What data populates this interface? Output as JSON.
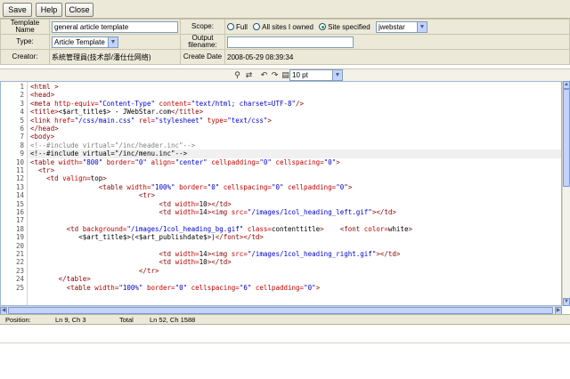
{
  "toolbar": {
    "save": "Save",
    "help": "Help",
    "close": "Close"
  },
  "form": {
    "template_name_label": "Template Name",
    "template_name_value": "general article template",
    "scope_label": "Scope:",
    "scope_options": [
      "Full",
      "All sites I owned",
      "Site specified"
    ],
    "scope_selected": "Site specified",
    "site_value": "jwebstar",
    "type_label": "Type:",
    "type_value": "Article Template",
    "output_label": "Output filename:",
    "output_value": "",
    "creator_label": "Creator:",
    "creator_value": "系統管理員(技术部/潘仕仕网络)",
    "create_date_label": "Create Date",
    "create_date_value": "2008-05-29 08:39:34"
  },
  "editor_tools": {
    "font_size": "10 pt",
    "icons": [
      "find-icon",
      "replace-icon",
      "undo-icon",
      "redo-icon",
      "font-size-icon"
    ]
  },
  "code": {
    "line_numbers": [
      "1",
      "2",
      "3",
      "4",
      "5",
      "6",
      "7",
      "8",
      "9",
      "10",
      "11",
      "12",
      "13",
      "14",
      "15",
      "16",
      "17",
      "18",
      "19",
      "20",
      "21",
      "22",
      "23",
      "24",
      "25"
    ],
    "current_line": 9,
    "lines": [
      {
        "i": "",
        "p": [
          [
            "tag",
            "<html >"
          ]
        ]
      },
      {
        "i": "",
        "p": [
          [
            "tag",
            "<head>"
          ]
        ]
      },
      {
        "i": "",
        "p": [
          [
            "tag",
            "<meta "
          ],
          [
            "attr",
            "http-equiv="
          ],
          [
            "val",
            "\"Content-Type\""
          ],
          [
            "attr",
            " content="
          ],
          [
            "val",
            "\"text/html; charset=UTF-8\""
          ],
          [
            "tag",
            "/>"
          ]
        ]
      },
      {
        "i": "",
        "p": [
          [
            "tag",
            "<title>"
          ],
          [
            "txt",
            "<$art_title$> - JWebStar.com"
          ],
          [
            "tag",
            "</title>"
          ]
        ]
      },
      {
        "i": "",
        "p": [
          [
            "tag",
            "<link "
          ],
          [
            "attr",
            "href="
          ],
          [
            "val",
            "\"/css/main.css\""
          ],
          [
            "attr",
            " rel="
          ],
          [
            "val",
            "\"stylesheet\""
          ],
          [
            "attr",
            " type="
          ],
          [
            "val",
            "\"text/css\""
          ],
          [
            "tag",
            ">"
          ]
        ]
      },
      {
        "i": "",
        "p": [
          [
            "tag",
            "</head>"
          ]
        ]
      },
      {
        "i": "",
        "p": [
          [
            "tag",
            "<body>"
          ]
        ]
      },
      {
        "i": "",
        "p": [
          [
            "com",
            "<!--#include virtual=\"/inc/header.inc\"-->"
          ]
        ]
      },
      {
        "i": "",
        "p": [
          [
            "txt",
            "<!--#include virtual=\"/inc/menu.inc\"-->"
          ]
        ]
      },
      {
        "i": "",
        "p": [
          [
            "tag",
            "<table "
          ],
          [
            "attr",
            "width="
          ],
          [
            "val",
            "\"800\""
          ],
          [
            "attr",
            " border="
          ],
          [
            "val",
            "\"0\""
          ],
          [
            "attr",
            " align="
          ],
          [
            "val",
            "\"center\""
          ],
          [
            "attr",
            " cellpadding="
          ],
          [
            "val",
            "\"0\""
          ],
          [
            "attr",
            " cellspacing="
          ],
          [
            "val",
            "\"0\""
          ],
          [
            "tag",
            ">"
          ]
        ]
      },
      {
        "i": "  ",
        "p": [
          [
            "tag",
            "<tr>"
          ]
        ]
      },
      {
        "i": "    ",
        "p": [
          [
            "tag",
            "<td "
          ],
          [
            "attr",
            "valign="
          ],
          [
            "txt",
            "top"
          ],
          [
            "tag",
            ">"
          ]
        ]
      },
      {
        "i": "                 ",
        "p": [
          [
            "tag",
            "<table "
          ],
          [
            "attr",
            "width="
          ],
          [
            "val",
            "\"100%\""
          ],
          [
            "attr",
            " border="
          ],
          [
            "val",
            "\"0\""
          ],
          [
            "attr",
            " cellspacing="
          ],
          [
            "val",
            "\"0\""
          ],
          [
            "attr",
            " cellpadding="
          ],
          [
            "val",
            "\"0\""
          ],
          [
            "tag",
            ">"
          ]
        ]
      },
      {
        "i": "                           ",
        "p": [
          [
            "tag",
            "<tr>"
          ]
        ]
      },
      {
        "i": "                                ",
        "p": [
          [
            "tag",
            "<td "
          ],
          [
            "attr",
            "width="
          ],
          [
            "txt",
            "10"
          ],
          [
            "tag",
            "></td>"
          ]
        ]
      },
      {
        "i": "                                ",
        "p": [
          [
            "tag",
            "<td "
          ],
          [
            "attr",
            "width="
          ],
          [
            "txt",
            "14"
          ],
          [
            "tag",
            "><img "
          ],
          [
            "attr",
            "src="
          ],
          [
            "val",
            "\"/images/1col_heading_left.gif\""
          ],
          [
            "tag",
            "></td>"
          ]
        ]
      },
      {
        "i": "",
        "p": []
      },
      {
        "i": "         ",
        "p": [
          [
            "tag",
            "<td "
          ],
          [
            "attr",
            "background="
          ],
          [
            "val",
            "\"/images/1col_heading_bg.gif\""
          ],
          [
            "attr",
            " class="
          ],
          [
            "txt",
            "contenttitle"
          ],
          [
            "tag",
            ">    <font "
          ],
          [
            "attr",
            "color="
          ],
          [
            "txt",
            "white"
          ],
          [
            "tag",
            ">"
          ]
        ]
      },
      {
        "i": "            ",
        "p": [
          [
            "txt",
            "<$art_title$>(<$art_publishdate$>)"
          ],
          [
            "tag",
            "</font></td>"
          ]
        ]
      },
      {
        "i": "",
        "p": []
      },
      {
        "i": "                                ",
        "p": [
          [
            "tag",
            "<td "
          ],
          [
            "attr",
            "width="
          ],
          [
            "txt",
            "14"
          ],
          [
            "tag",
            "><img "
          ],
          [
            "attr",
            "src="
          ],
          [
            "val",
            "\"/images/1col_heading_right.gif\""
          ],
          [
            "tag",
            "></td>"
          ]
        ]
      },
      {
        "i": "                                ",
        "p": [
          [
            "tag",
            "<td "
          ],
          [
            "attr",
            "width="
          ],
          [
            "txt",
            "10"
          ],
          [
            "tag",
            "></td>"
          ]
        ]
      },
      {
        "i": "                           ",
        "p": [
          [
            "tag",
            "</tr>"
          ]
        ]
      },
      {
        "i": "       ",
        "p": [
          [
            "tag",
            "</table>"
          ]
        ]
      },
      {
        "i": "         ",
        "p": [
          [
            "tag",
            "<table "
          ],
          [
            "attr",
            "width="
          ],
          [
            "val",
            "\"100%\""
          ],
          [
            "attr",
            " border="
          ],
          [
            "val",
            "\"0\""
          ],
          [
            "attr",
            " cellspacing="
          ],
          [
            "val",
            "\"6\""
          ],
          [
            "attr",
            " cellpadding="
          ],
          [
            "val",
            "\"0\""
          ],
          [
            "tag",
            ">"
          ]
        ]
      }
    ]
  },
  "status": {
    "position_label": "Position:",
    "position_value": "Ln 9, Ch 3",
    "total_label": "Total",
    "total_value": "Ln 52, Ch 1588"
  }
}
